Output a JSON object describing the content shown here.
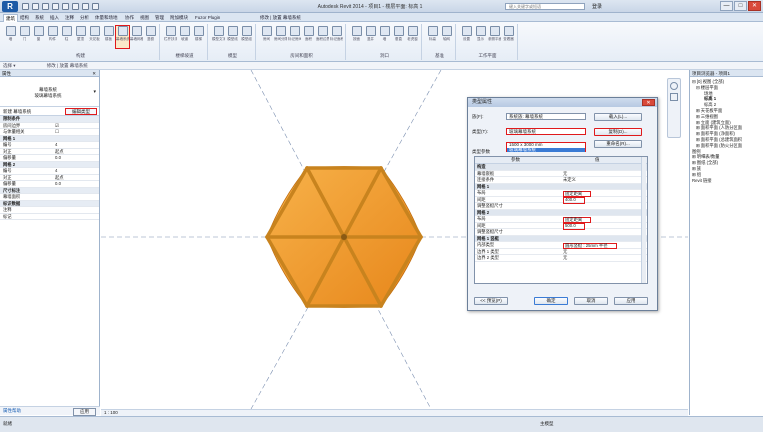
{
  "app": {
    "title": "Autodesk Revit 2014 - 项目1 - 楼层平面: 标高 1",
    "logo": "R",
    "search_placeholder": "键入关键字或短语",
    "user_label": "登录",
    "controls": [
      "—",
      "□",
      "✕"
    ]
  },
  "ribbon": {
    "tabs": [
      "建筑",
      "结构",
      "系统",
      "插入",
      "注释",
      "分析",
      "体量和场地",
      "协作",
      "视图",
      "管理",
      "附加模块",
      "Fuzor Plugin",
      "修改 | 放置 幕墙系统"
    ],
    "active_tab": "建筑",
    "groups": [
      {
        "label": "构建",
        "buttons": [
          "墙",
          "门",
          "窗",
          "构件",
          "柱",
          "屋顶",
          "天花板",
          "楼板",
          "幕墙系统",
          "幕墙网格",
          "竖梃"
        ]
      },
      {
        "label": "楼梯坡道",
        "buttons": [
          "栏杆扶手",
          "坡道",
          "楼梯"
        ]
      },
      {
        "label": "模型",
        "buttons": [
          "模型文字",
          "模型线",
          "模型组"
        ]
      },
      {
        "label": "房间和面积",
        "buttons": [
          "房间",
          "房间分隔",
          "标记房间",
          "面积",
          "面积边界",
          "标记面积"
        ]
      },
      {
        "label": "洞口",
        "buttons": [
          "按面",
          "竖井",
          "墙",
          "垂直",
          "老虎窗"
        ]
      },
      {
        "label": "基准",
        "buttons": [
          "标高",
          "轴网"
        ]
      },
      {
        "label": "工作平面",
        "buttons": [
          "设置",
          "显示",
          "参照平面",
          "查看器"
        ]
      }
    ],
    "highlighted_button": "幕墙系统",
    "select_label": "选择 ▾"
  },
  "options_bar": "修改 | 放置 幕墙系统",
  "properties": {
    "header": "属性",
    "type_name_line1": "幕墙系统",
    "type_name_line2": "玻璃幕墙系统",
    "instance_selector": "新建 幕墙系统",
    "edit_type": "编辑类型",
    "rows": [
      {
        "k": "限制条件",
        "v": "",
        "cat": true
      },
      {
        "k": "房间边界",
        "v": "☑",
        "cat": false
      },
      {
        "k": "与体量相关",
        "v": "☐",
        "cat": false
      },
      {
        "k": "网格 1",
        "v": "",
        "cat": true
      },
      {
        "k": "编号",
        "v": "4",
        "cat": false
      },
      {
        "k": "对正",
        "v": "起点",
        "cat": false
      },
      {
        "k": "偏移量",
        "v": "0.0",
        "cat": false
      },
      {
        "k": "网格 2",
        "v": "",
        "cat": true
      },
      {
        "k": "编号",
        "v": "4",
        "cat": false
      },
      {
        "k": "对正",
        "v": "起点",
        "cat": false
      },
      {
        "k": "偏移量",
        "v": "0.0",
        "cat": false
      },
      {
        "k": "尺寸标注",
        "v": "",
        "cat": true
      },
      {
        "k": "幕墙面积",
        "v": "",
        "cat": false
      },
      {
        "k": "标识数据",
        "v": "",
        "cat": true
      },
      {
        "k": "注释",
        "v": "",
        "cat": false
      },
      {
        "k": "标记",
        "v": "",
        "cat": false
      }
    ],
    "help_link": "属性帮助",
    "apply": "应用"
  },
  "browser": {
    "header": "项目浏览器 - 项目1",
    "items": [
      {
        "text": "⊟ [0] 视图 (全部)",
        "indent": 0
      },
      {
        "text": "⊟ 楼层平面",
        "indent": 1
      },
      {
        "text": "场地",
        "indent": 3
      },
      {
        "text": "标高 1",
        "indent": 3,
        "bold": true
      },
      {
        "text": "标高 2",
        "indent": 3
      },
      {
        "text": "⊞ 天花板平面",
        "indent": 1
      },
      {
        "text": "⊞ 三维视图",
        "indent": 1
      },
      {
        "text": "⊞ 立面 (建筑立面)",
        "indent": 1
      },
      {
        "text": "⊞ 面积平面 (人防分区面",
        "indent": 1
      },
      {
        "text": "⊞ 面积平面 (净面积)",
        "indent": 1
      },
      {
        "text": "⊞ 面积平面 (总建筑面积",
        "indent": 1
      },
      {
        "text": "⊞ 面积平面 (防火分区面",
        "indent": 1
      },
      {
        "text": "图例",
        "indent": 0
      },
      {
        "text": "⊞ 明细表/数量",
        "indent": 0
      },
      {
        "text": "⊞ 图纸 (全部)",
        "indent": 0
      },
      {
        "text": "⊞ 族",
        "indent": 0
      },
      {
        "text": "⊞ 组",
        "indent": 0
      },
      {
        "text": "Revit 链接",
        "indent": 0
      }
    ]
  },
  "view_bar": "1 : 100",
  "status_bar": "就绪",
  "status_model": "主模型",
  "dialog": {
    "title": "类型属性",
    "family_label": "族(F):",
    "family_value": "系统族: 幕墙系统",
    "type_label": "类型(T):",
    "type_value": "玻璃幕墙系统",
    "dropdown": [
      "1500 x 3000 mm",
      "玻璃幕墙系统"
    ],
    "load_btn": "载入(L)...",
    "duplicate_btn": "复制(D)...",
    "rename_btn": "重命名(R)...",
    "type_params_label": "类型参数",
    "col_param": "参数",
    "col_value": "值",
    "rows": [
      {
        "k": "构造",
        "v": "",
        "cat": true
      },
      {
        "k": "幕墙嵌板",
        "v": "无",
        "cat": false
      },
      {
        "k": "连接条件",
        "v": "未定义",
        "cat": false
      },
      {
        "k": "网格 1",
        "v": "",
        "cat": true
      },
      {
        "k": "布局",
        "v": "固定距离",
        "cat": false
      },
      {
        "k": "间距",
        "v": "400.0",
        "cat": false
      },
      {
        "k": "调整竖梃尺寸",
        "v": "",
        "cat": false
      },
      {
        "k": "网格 2",
        "v": "",
        "cat": true
      },
      {
        "k": "布局",
        "v": "固定距离",
        "cat": false
      },
      {
        "k": "间距",
        "v": "500.0",
        "cat": false
      },
      {
        "k": "调整竖梃尺寸",
        "v": "",
        "cat": false
      },
      {
        "k": "网格 1 竖梃",
        "v": "",
        "cat": true
      },
      {
        "k": "内部类型",
        "v": "圆形竖梃 : 25mm 半径",
        "cat": false
      },
      {
        "k": "边界 1 类型",
        "v": "无",
        "cat": false
      },
      {
        "k": "边界 2 类型",
        "v": "无",
        "cat": false
      }
    ],
    "preview_btn": "<< 预览(P)",
    "ok_btn": "确定",
    "cancel_btn": "取消",
    "apply_btn": "应用"
  },
  "colors": {
    "accent": "#e0191b",
    "canopy_orange": "#f39a1e",
    "mullion": "#c8831e"
  }
}
